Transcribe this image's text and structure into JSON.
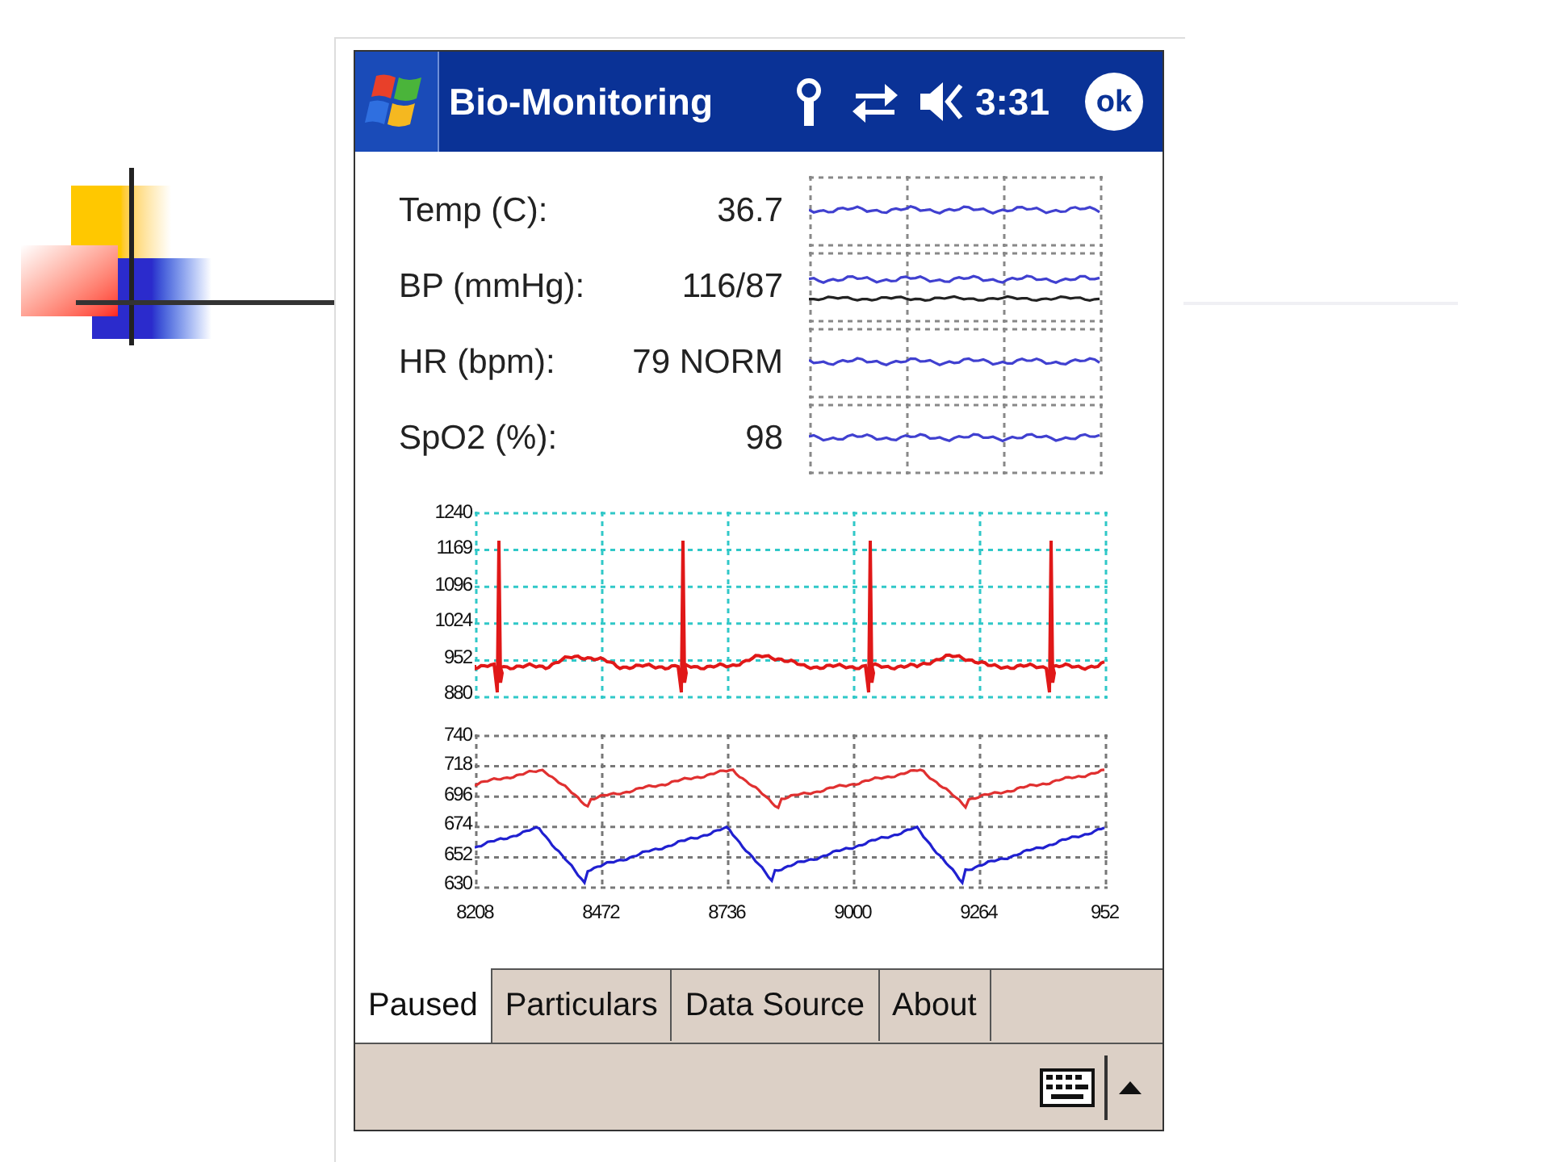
{
  "title_bar": {
    "title": "Bio-Monitoring",
    "time": "3:31",
    "ok_label": "ok"
  },
  "vitals": [
    {
      "label": "Temp (C):",
      "value": "36.7",
      "kind": "single"
    },
    {
      "label": "BP (mmHg):",
      "value": "116/87",
      "kind": "dual"
    },
    {
      "label": "HR (bpm):",
      "value": "79 NORM",
      "kind": "single"
    },
    {
      "label": "SpO2 (%):",
      "value": "98",
      "kind": "single"
    }
  ],
  "ecg_chart": {
    "y_ticks": [
      "1240",
      "1169",
      "1096",
      "1024",
      "952",
      "880"
    ]
  },
  "pressure_chart": {
    "y_ticks": [
      "740",
      "718",
      "696",
      "674",
      "652",
      "630"
    ],
    "x_ticks": [
      "8208",
      "8472",
      "8736",
      "9000",
      "9264",
      "952"
    ]
  },
  "tabs": [
    {
      "label": "Paused",
      "selected": true
    },
    {
      "label": "Particulars",
      "selected": false
    },
    {
      "label": "Data Source",
      "selected": false
    },
    {
      "label": "About",
      "selected": false
    }
  ]
}
